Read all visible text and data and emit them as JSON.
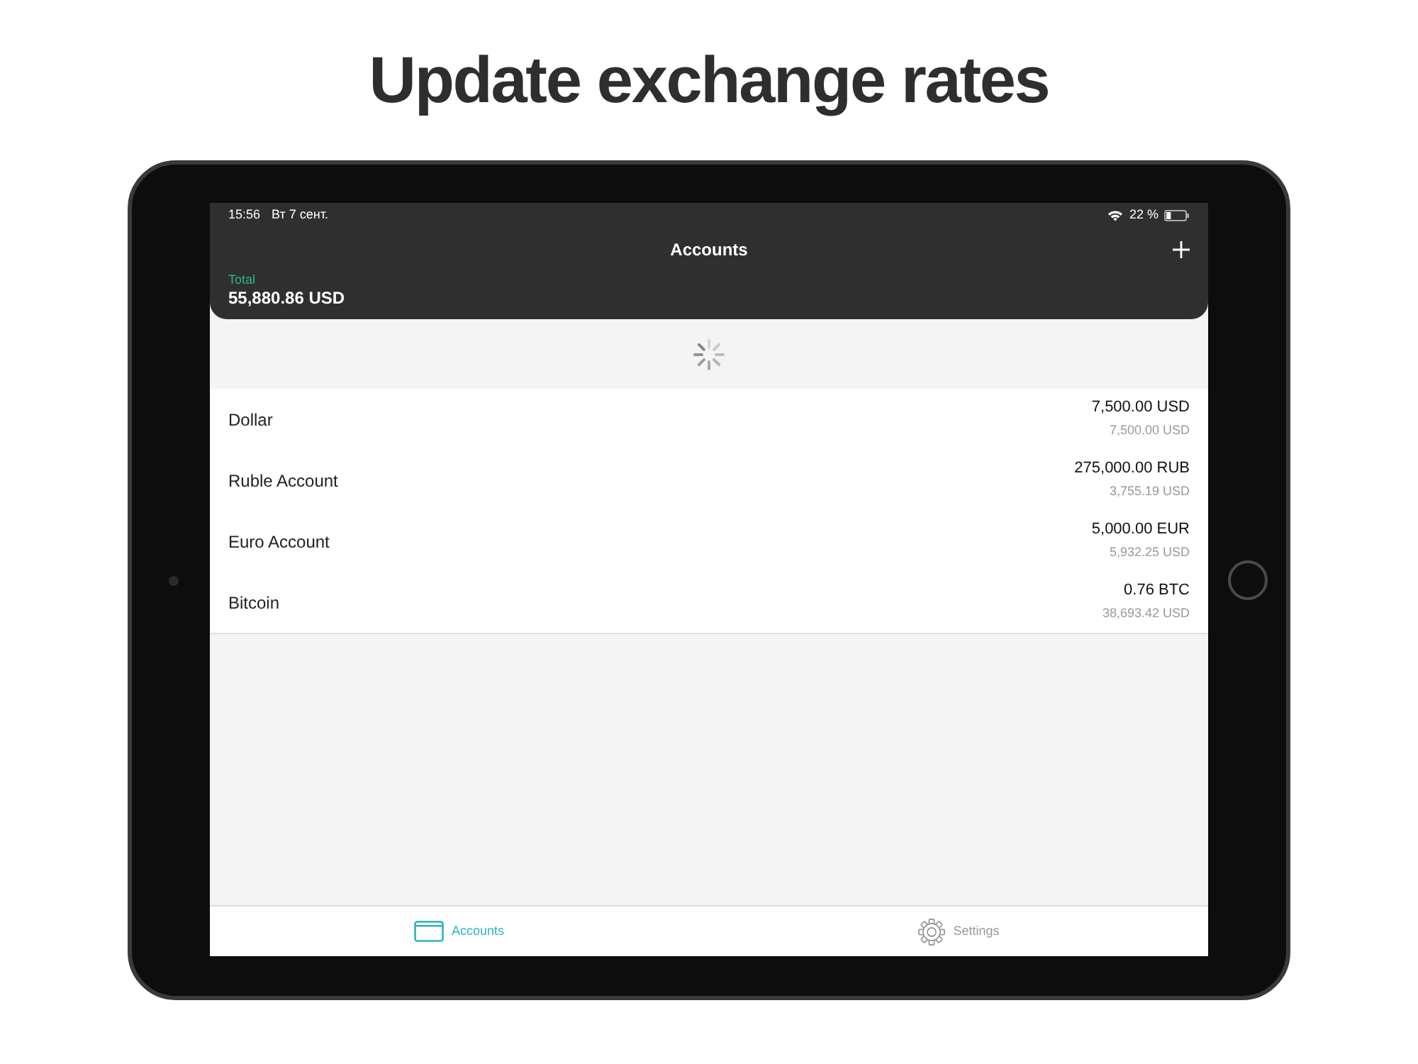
{
  "headline": "Update exchange rates",
  "status_bar": {
    "time": "15:56",
    "date": "Вт 7 сент.",
    "battery": "22 %"
  },
  "nav": {
    "title": "Accounts"
  },
  "total": {
    "label": "Total",
    "value": "55,880.86 USD"
  },
  "refreshing": true,
  "accounts": [
    {
      "name": "Dollar",
      "amount": "7,500.00 USD",
      "converted": "7,500.00 USD"
    },
    {
      "name": "Ruble Account",
      "amount": "275,000.00 RUB",
      "converted": "3,755.19 USD"
    },
    {
      "name": "Euro Account",
      "amount": "5,000.00 EUR",
      "converted": "5,932.25 USD"
    },
    {
      "name": "Bitcoin",
      "amount": "0.76 BTC",
      "converted": "38,693.42 USD"
    }
  ],
  "tabs": [
    {
      "label": "Accounts",
      "kind": "accounts",
      "selected": true
    },
    {
      "label": "Settings",
      "kind": "settings",
      "selected": false
    }
  ]
}
